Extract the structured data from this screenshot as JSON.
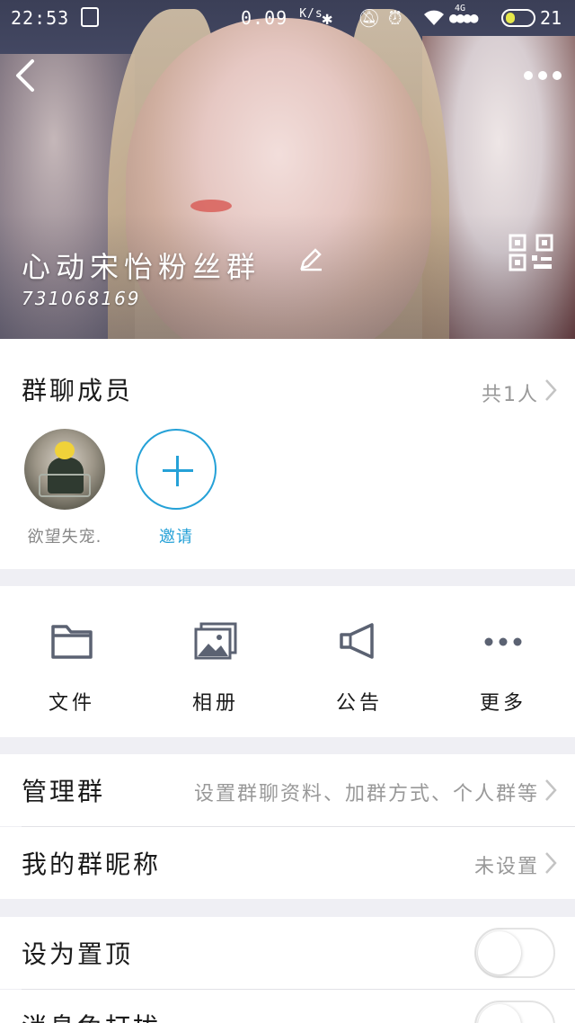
{
  "status_bar": {
    "time": "22:53",
    "speed": "0.09",
    "speed_unit": "K/s",
    "network": "4G",
    "battery": "21"
  },
  "header": {
    "group_name": "心动宋怡粉丝群",
    "group_id": "731068169",
    "back_icon": "chevron-left-icon",
    "more_icon": "more-dots-icon",
    "qr_icon": "qr-code-icon",
    "edit_icon": "pencil-icon"
  },
  "members": {
    "title": "群聊成员",
    "count_text": "共1人",
    "list": [
      {
        "name": "欲望失宠."
      }
    ],
    "invite_label": "邀请"
  },
  "features": [
    {
      "label": "文件",
      "icon": "folder-icon"
    },
    {
      "label": "相册",
      "icon": "album-icon"
    },
    {
      "label": "公告",
      "icon": "megaphone-icon"
    },
    {
      "label": "更多",
      "icon": "more-dots-icon"
    }
  ],
  "manage": {
    "label": "管理群",
    "detail": "设置群聊资料、加群方式、个人群等"
  },
  "nickname": {
    "label": "我的群昵称",
    "value": "未设置"
  },
  "settings": [
    {
      "label": "设为置顶",
      "on": false
    },
    {
      "label": "消息免打扰",
      "on": false
    }
  ],
  "colors": {
    "accent": "#25a1d7",
    "background": "#efeff4"
  }
}
